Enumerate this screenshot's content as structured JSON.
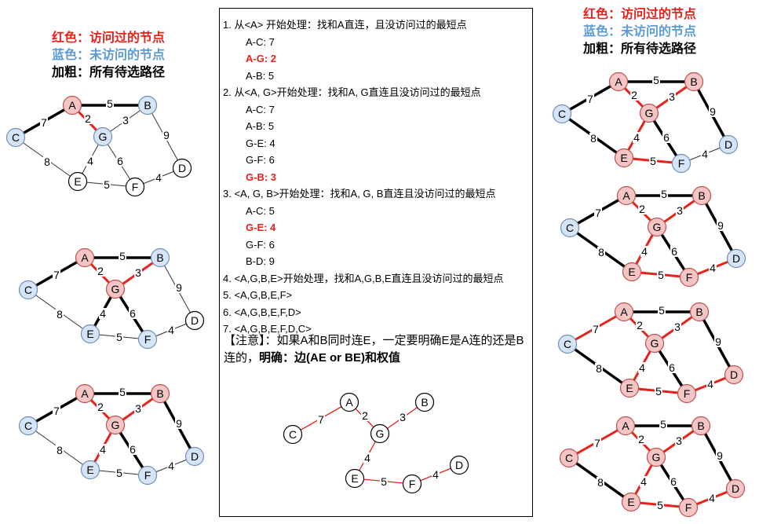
{
  "legend": {
    "red_label": "红色：访问过的节点",
    "blue_label": "蓝色：未访问的节点",
    "bold_label": "加粗：所有待选路径"
  },
  "colors": {
    "visited_fill": "#f4c5c5",
    "visited_stroke": "#c0504d",
    "unvisited_fill": "#d6e4f7",
    "unvisited_stroke": "#6f8fb5",
    "plain_fill": "#ffffff",
    "red_edge": "#e8211b",
    "text_red": "#e8211b",
    "text_blue": "#5b9bd5"
  },
  "steps": [
    {
      "text": "1. 从<A> 开始处理：找和A直连，且没访问过的最短点",
      "sub": false,
      "hl": false
    },
    {
      "text": "A-C:  7",
      "sub": true,
      "hl": false
    },
    {
      "text": "A-G:  2",
      "sub": true,
      "hl": true
    },
    {
      "text": "A-B:  5",
      "sub": true,
      "hl": false
    },
    {
      "text": "2. 从<A, G>开始处理：找和A, G直连且没访问过的最短点",
      "sub": false,
      "hl": false
    },
    {
      "text": "A-C:  7",
      "sub": true,
      "hl": false
    },
    {
      "text": "A-B:  5",
      "sub": true,
      "hl": false
    },
    {
      "text": "G-E:  4",
      "sub": true,
      "hl": false
    },
    {
      "text": "G-F:  6",
      "sub": true,
      "hl": false
    },
    {
      "text": "G-B:  3",
      "sub": true,
      "hl": true
    },
    {
      "text": "3. <A, G, B>开始处理：找和A, G, B直连且没访问过的最短点",
      "sub": false,
      "hl": false
    },
    {
      "text": "A-C:  5",
      "sub": true,
      "hl": false
    },
    {
      "text": "G-E:  4",
      "sub": true,
      "hl": true
    },
    {
      "text": "G-F:  6",
      "sub": true,
      "hl": false
    },
    {
      "text": "B-D:  9",
      "sub": true,
      "hl": false
    },
    {
      "text": "4. <A,G,B,E>开始处理，找和A,G,B,E直连且没访问过的最短点",
      "sub": false,
      "hl": false
    },
    {
      "text": "5. <A,G,B,E,F>",
      "sub": false,
      "hl": false
    },
    {
      "text": "6. <A,G,B,E,F,D>",
      "sub": false,
      "hl": false
    },
    {
      "text": "7. <A,G,B,E,F,D,C>",
      "sub": false,
      "hl": false
    }
  ],
  "note": {
    "part1": "【注意】：如果A和B同时连E，一定要明确E是A连的还是B连的，",
    "part2": "明确：边(AE or BE)和权值"
  },
  "graph": {
    "nodes": [
      "A",
      "B",
      "C",
      "D",
      "E",
      "F",
      "G"
    ],
    "edges": [
      {
        "id": "AB",
        "from": "A",
        "to": "B",
        "w": "5"
      },
      {
        "id": "AC",
        "from": "A",
        "to": "C",
        "w": "7"
      },
      {
        "id": "AG",
        "from": "A",
        "to": "G",
        "w": "2"
      },
      {
        "id": "GB",
        "from": "G",
        "to": "B",
        "w": "3"
      },
      {
        "id": "BD",
        "from": "B",
        "to": "D",
        "w": "9"
      },
      {
        "id": "CE",
        "from": "C",
        "to": "E",
        "w": "8"
      },
      {
        "id": "GE",
        "from": "G",
        "to": "E",
        "w": "4"
      },
      {
        "id": "GF",
        "from": "G",
        "to": "F",
        "w": "6"
      },
      {
        "id": "EF",
        "from": "E",
        "to": "F",
        "w": "5"
      },
      {
        "id": "FD",
        "from": "F",
        "to": "D",
        "w": "4"
      }
    ]
  },
  "states": [
    {
      "visited": [
        "A"
      ],
      "unvisited": [
        "B",
        "C",
        "G"
      ],
      "red": [
        "AG"
      ],
      "bold": [
        "AB",
        "AC",
        "AG"
      ],
      "hidden": []
    },
    {
      "visited": [
        "A",
        "G"
      ],
      "unvisited": [
        "B",
        "C",
        "E",
        "F"
      ],
      "red": [
        "AG",
        "GB"
      ],
      "bold": [
        "AB",
        "AC",
        "GB",
        "GE",
        "GF"
      ],
      "hidden": []
    },
    {
      "visited": [
        "A",
        "B",
        "G"
      ],
      "unvisited": [
        "C",
        "D",
        "E",
        "F"
      ],
      "red": [
        "AG",
        "GB",
        "GE"
      ],
      "bold": [
        "AB",
        "AC",
        "BD",
        "GE",
        "GF"
      ],
      "hidden": []
    },
    {
      "visited": [
        "A",
        "B",
        "E",
        "G"
      ],
      "unvisited": [
        "C",
        "D",
        "F"
      ],
      "red": [
        "AG",
        "GB",
        "GE",
        "EF"
      ],
      "bold": [
        "AB",
        "AC",
        "BD",
        "CE",
        "EF",
        "GF"
      ],
      "hidden": []
    },
    {
      "visited": [
        "A",
        "B",
        "E",
        "F",
        "G"
      ],
      "unvisited": [
        "C",
        "D"
      ],
      "red": [
        "AG",
        "GB",
        "GE",
        "EF",
        "FD"
      ],
      "bold": [
        "AB",
        "AC",
        "BD",
        "CE",
        "FD",
        "GF"
      ],
      "hidden": []
    },
    {
      "visited": [
        "A",
        "B",
        "D",
        "E",
        "F",
        "G"
      ],
      "unvisited": [
        "C"
      ],
      "red": [
        "AG",
        "GB",
        "GE",
        "EF",
        "FD",
        "AC"
      ],
      "bold": [
        "AB",
        "AC",
        "BD",
        "CE",
        "GF"
      ],
      "hidden": []
    },
    {
      "visited": [
        "A",
        "B",
        "C",
        "D",
        "E",
        "F",
        "G"
      ],
      "unvisited": [],
      "red": [
        "AG",
        "GB",
        "GE",
        "EF",
        "FD",
        "AC"
      ],
      "bold": [
        "AB",
        "BD",
        "CE",
        "GF"
      ],
      "hidden": []
    },
    {
      "visited": [],
      "unvisited": [],
      "red": [
        "AC",
        "AG",
        "GB",
        "GE",
        "EF",
        "FD"
      ],
      "bold": [],
      "hidden": [
        "AB",
        "BD",
        "CE",
        "GF"
      ],
      "thin_red": true
    }
  ]
}
